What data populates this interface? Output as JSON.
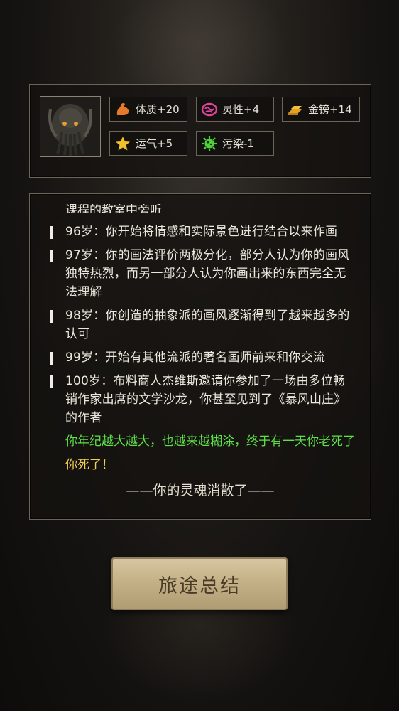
{
  "stats": [
    {
      "label": "体质+20",
      "icon": "muscle-arm-icon",
      "color": "#e8782a"
    },
    {
      "label": "灵性+4",
      "icon": "brain-icon",
      "color": "#e0449a"
    },
    {
      "label": "金镑+14",
      "icon": "gold-bars-icon",
      "color": "#e0a328"
    },
    {
      "label": "运气+5",
      "icon": "star-icon",
      "color": "#f2c02a"
    },
    {
      "label": "污染-1",
      "icon": "virus-icon",
      "color": "#4fd13a"
    }
  ],
  "log": {
    "partial_top": "课程的教室中旁听",
    "entries": [
      "96岁：你开始将情感和实际景色进行结合以来作画",
      "97岁：你的画法评价两极分化，部分人认为你的画风独特热烈，而另一部分人认为你画出来的东西完全无法理解",
      "98岁：你创造的抽象派的画风逐渐得到了越来越多的认可",
      "99岁：开始有其他流派的著名画师前来和你交流",
      "100岁：布料商人杰维斯邀请你参加了一场由多位畅销作家出席的文学沙龙，你甚至见到了《暴风山庄》的作者"
    ],
    "old_age": "你年纪越大越大，也越来越糊涂，终于有一天你老死了",
    "died": "你死了！",
    "soul": "——你的灵魂消散了——"
  },
  "buttons": {
    "summary": "旅途总结"
  },
  "colors": {
    "green": "#5fe04a",
    "yellow": "#f2cf55"
  }
}
